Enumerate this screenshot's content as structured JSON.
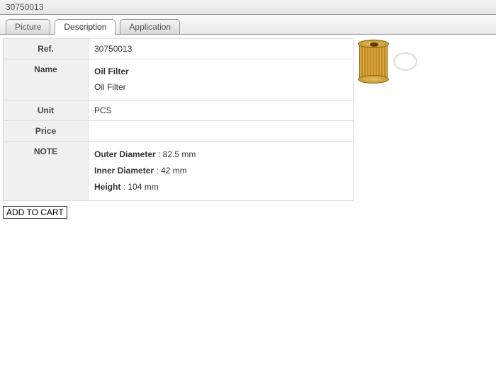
{
  "titlebar": {
    "text": "30750013"
  },
  "tabs": {
    "picture": "Picture",
    "description": "Description",
    "application": "Application"
  },
  "labels": {
    "ref": "Ref.",
    "name": "Name",
    "unit": "Unit",
    "price": "Price",
    "note": "NOTE"
  },
  "values": {
    "ref": "30750013",
    "name_line1": "Oil Filter",
    "name_line2": "Oil Filter",
    "unit": "PCS",
    "price": ""
  },
  "note": {
    "od_label": "Outer Diameter",
    "od_value": " : 82.5 mm",
    "id_label": "Inner Diameter",
    "id_value": " : 42 mm",
    "h_label": "Height",
    "h_value": " : 104 mm"
  },
  "buttons": {
    "add_to_cart": "ADD TO CART"
  }
}
